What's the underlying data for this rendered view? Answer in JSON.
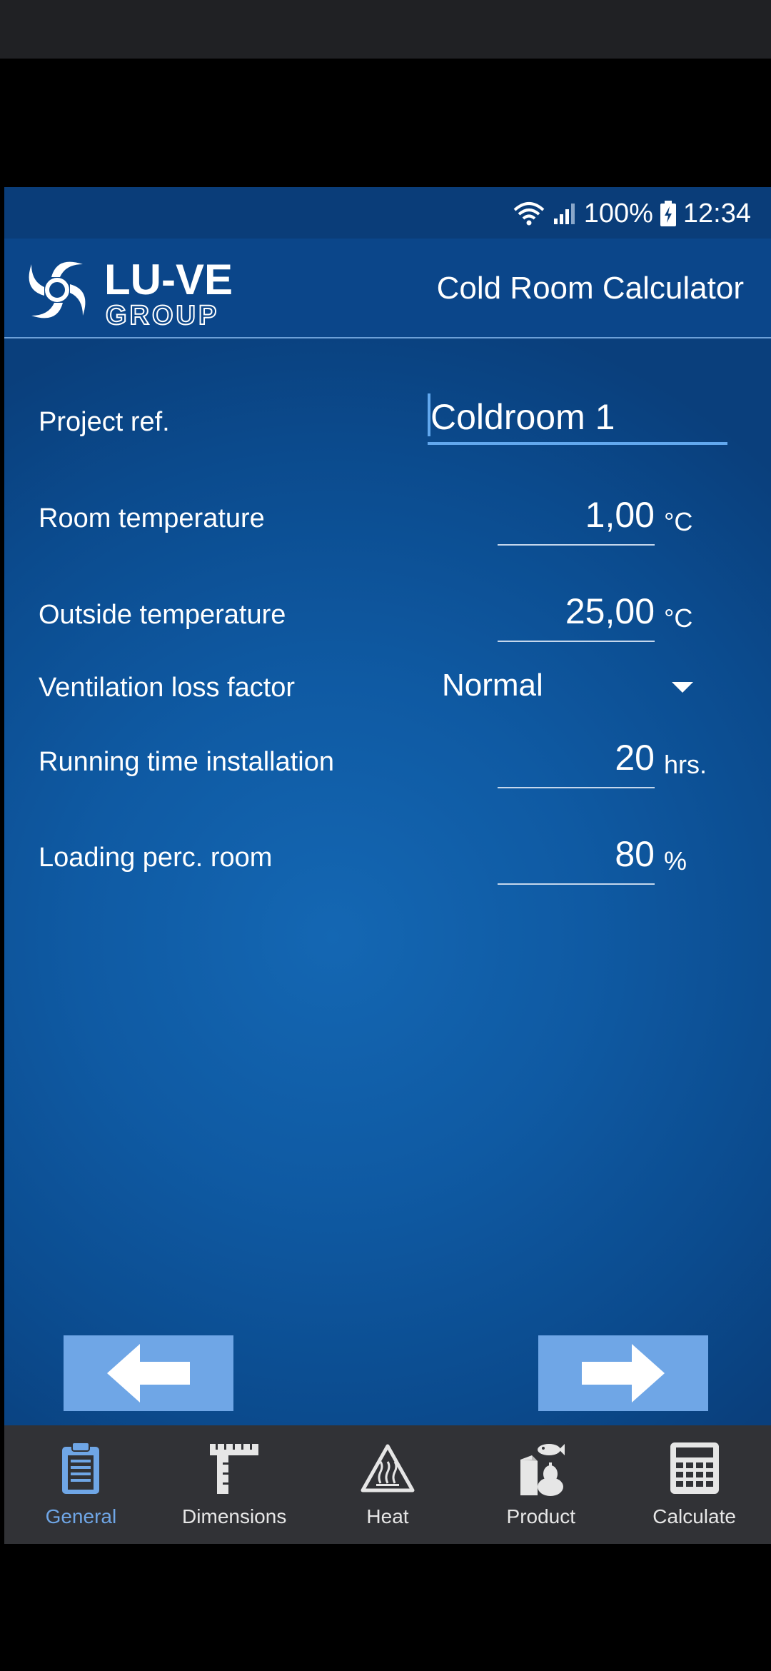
{
  "status_bar": {
    "battery": "100%",
    "time": "12:34"
  },
  "header": {
    "logo_main": "LU-VE",
    "logo_sub": "GROUP",
    "title": "Cold Room Calculator"
  },
  "form": {
    "project_ref": {
      "label": "Project ref.",
      "value": "Coldroom 1"
    },
    "room_temperature": {
      "label": "Room temperature",
      "value": "1,00",
      "unit": "°C"
    },
    "outside_temperature": {
      "label": "Outside temperature",
      "value": "25,00",
      "unit": "°C"
    },
    "ventilation_loss_factor": {
      "label": "Ventilation loss factor",
      "value": "Normal"
    },
    "running_time": {
      "label": "Running time installation",
      "value": "20",
      "unit": "hrs."
    },
    "loading_perc": {
      "label": "Loading perc. room",
      "value": "80",
      "unit": "%"
    }
  },
  "tabs": [
    {
      "label": "General",
      "icon": "clipboard-icon",
      "active": true
    },
    {
      "label": "Dimensions",
      "icon": "ruler-icon"
    },
    {
      "label": "Heat",
      "icon": "heat-warning-icon"
    },
    {
      "label": "Product",
      "icon": "product-icon"
    },
    {
      "label": "Calculate",
      "icon": "calculator-icon"
    }
  ],
  "colors": {
    "accent": "#6fa6e6",
    "background": "#0f5aa3",
    "tabbar": "#313236"
  }
}
